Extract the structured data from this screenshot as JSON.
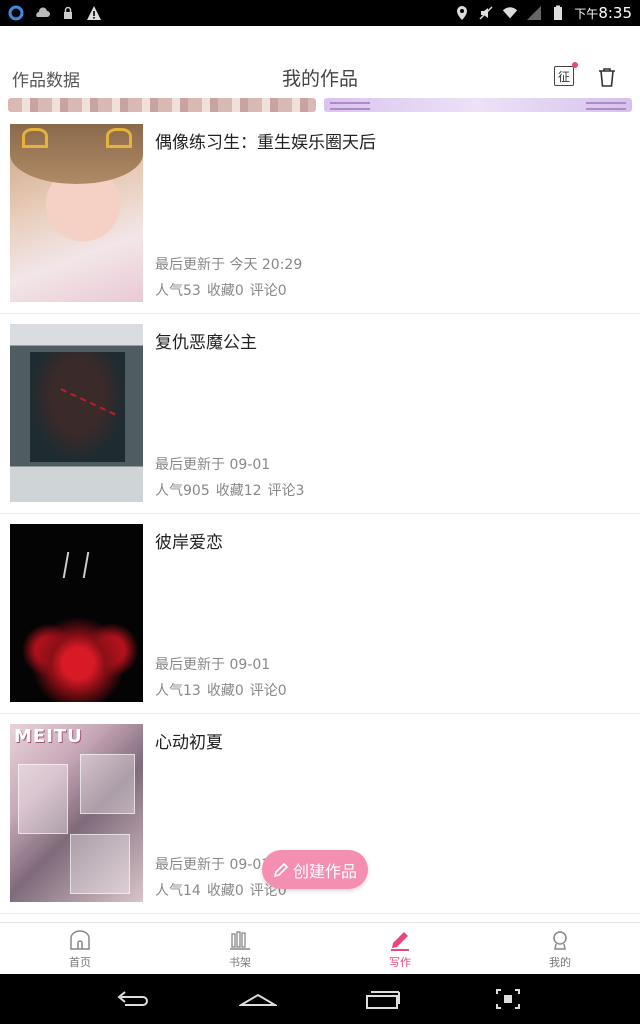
{
  "status_bar": {
    "time_prefix": "下午",
    "time": "8:35"
  },
  "header": {
    "left_link": "作品数据",
    "title": "我的作品",
    "cert_glyph": "征"
  },
  "works": [
    {
      "title": "偶像练习生：重生娱乐圈天后",
      "updated": "最后更新于 今天 20:29",
      "popularity": "人气53",
      "favorites": "收藏0",
      "comments": "评论0"
    },
    {
      "title": "复仇恶魔公主",
      "updated": "最后更新于 09-01",
      "popularity": "人气905",
      "favorites": "收藏12",
      "comments": "评论3"
    },
    {
      "title": "彼岸爱恋",
      "updated": "最后更新于 09-01",
      "popularity": "人气13",
      "favorites": "收藏0",
      "comments": "评论0"
    },
    {
      "title": "心动初夏",
      "updated": "最后更新于 09-01",
      "popularity": "人气14",
      "favorites": "收藏0",
      "comments": "评论0",
      "cover_text": "MEITU"
    }
  ],
  "fab": {
    "label": "创建作品"
  },
  "tabs": [
    {
      "label": "首页",
      "icon": "home-icon"
    },
    {
      "label": "书架",
      "icon": "bookshelf-icon"
    },
    {
      "label": "写作",
      "icon": "pencil-icon",
      "active": true
    },
    {
      "label": "我的",
      "icon": "profile-icon"
    }
  ],
  "colors": {
    "accent": "#e8467c",
    "fab": "#f48fb1"
  }
}
